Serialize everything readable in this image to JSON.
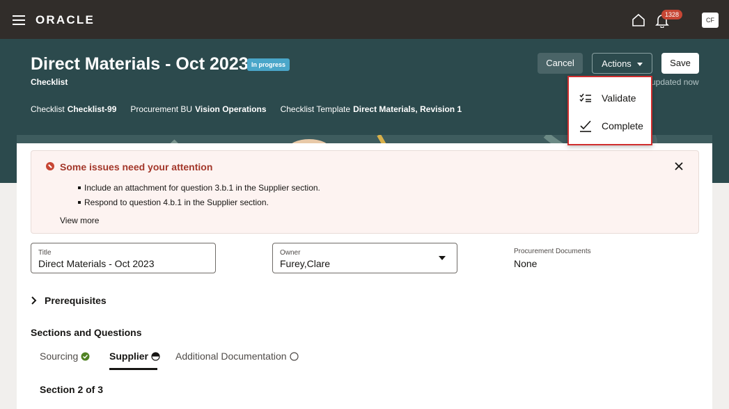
{
  "topbar": {
    "brand": "ORACLE",
    "notification_count": "1328",
    "avatar_initials": "CF"
  },
  "header": {
    "title": "Direct Materials - Oct 2023",
    "status": "In progress",
    "subtitle": "Checklist",
    "updated": "updated now",
    "meta": [
      {
        "label": "Checklist",
        "value": "Checklist-99"
      },
      {
        "label": "Procurement BU",
        "value": "Vision Operations"
      },
      {
        "label": "Checklist Template",
        "value": "Direct Materials, Revision 1"
      }
    ],
    "buttons": {
      "cancel": "Cancel",
      "actions": "Actions",
      "save": "Save"
    }
  },
  "actions_menu": {
    "items": [
      {
        "label": "Validate",
        "icon": "checklist-icon"
      },
      {
        "label": "Complete",
        "icon": "check-icon"
      }
    ]
  },
  "alert": {
    "title": "Some issues need your attention",
    "items": [
      "Include an attachment for question 3.b.1 in the Supplier section.",
      "Respond to question 4.b.1 in the Supplier section."
    ],
    "view_more": "View more"
  },
  "form": {
    "title": {
      "label": "Title",
      "value": "Direct Materials - Oct 2023"
    },
    "owner": {
      "label": "Owner",
      "value": "Furey,Clare"
    },
    "procurement_documents": {
      "label": "Procurement Documents",
      "value": "None"
    }
  },
  "prerequisites": {
    "label": "Prerequisites"
  },
  "sections": {
    "title": "Sections and Questions",
    "tabs": [
      {
        "label": "Sourcing",
        "status": "complete"
      },
      {
        "label": "Supplier",
        "status": "in-progress"
      },
      {
        "label": "Additional Documentation",
        "status": "not-started"
      }
    ],
    "current": "Section 2 of 3"
  },
  "colors": {
    "topbar": "#312d2a",
    "header": "#2c4a4d",
    "error": "#c74634",
    "status_badge": "#4aa6c9",
    "complete_green": "#508223",
    "menu_highlight": "#d12e2e"
  }
}
